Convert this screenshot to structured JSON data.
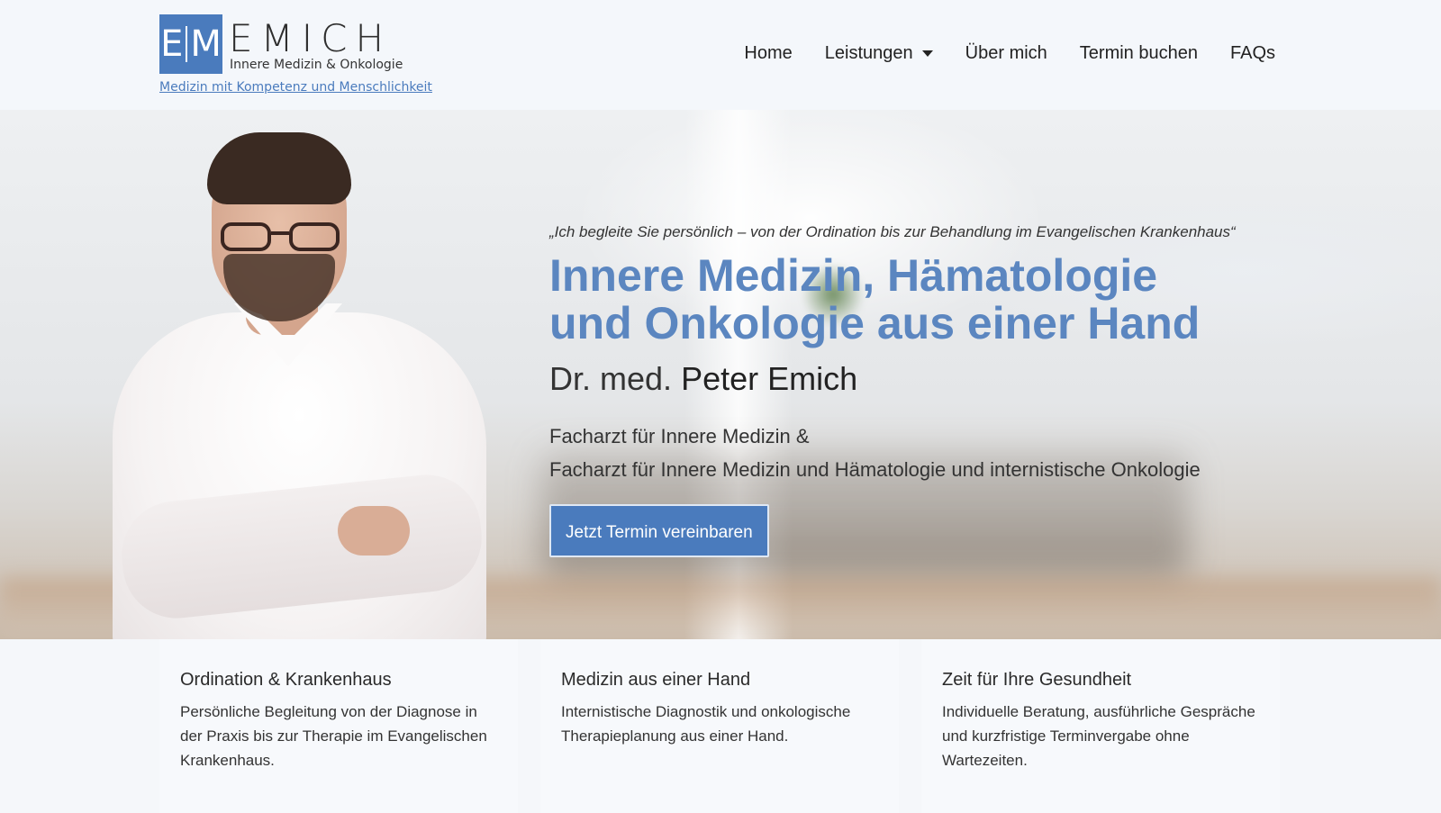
{
  "brand": {
    "logo_letters": "E|M",
    "name": "EMICH",
    "subtitle": "Innere Medizin & Onkologie",
    "tagline": "Medizin mit Kompetenz und Menschlichkeit",
    "accent_color": "#4a7bbd"
  },
  "nav": {
    "items": [
      {
        "label": "Home"
      },
      {
        "label": "Leistungen",
        "has_dropdown": true
      },
      {
        "label": "Über mich"
      },
      {
        "label": "Termin buchen"
      },
      {
        "label": "FAQs"
      }
    ]
  },
  "hero": {
    "quote": "„Ich begleite Sie persönlich – von der Ordination bis zur Behandlung im Evangelischen Krankenhaus“",
    "headline_line1": "Innere Medizin, Hämatologie",
    "headline_line2": "und Onkologie aus einer Hand",
    "doctor_title": "Dr. med.",
    "doctor_name": "Peter Emich",
    "specialty_line1": "Facharzt für Innere Medizin &",
    "specialty_line2": "Facharzt für Innere Medizin und Hämatologie und internistische Onkologie",
    "cta_label": "Jetzt Termin vereinbaren",
    "headline_color": "#5b86c0"
  },
  "cards": [
    {
      "title": "Ordination & Krankenhaus",
      "text": "Persönliche Begleitung von der Diagnose in der Praxis bis zur Therapie im Evangelischen Krankenhaus."
    },
    {
      "title": "Medizin aus einer Hand",
      "text": "Internistische Diagnostik und onkologische Therapieplanung aus einer Hand."
    },
    {
      "title": "Zeit für Ihre Gesundheit",
      "text": "Individuelle Beratung, ausführliche Gespräche und kurzfristige Terminvergabe ohne Wartezeiten."
    }
  ]
}
